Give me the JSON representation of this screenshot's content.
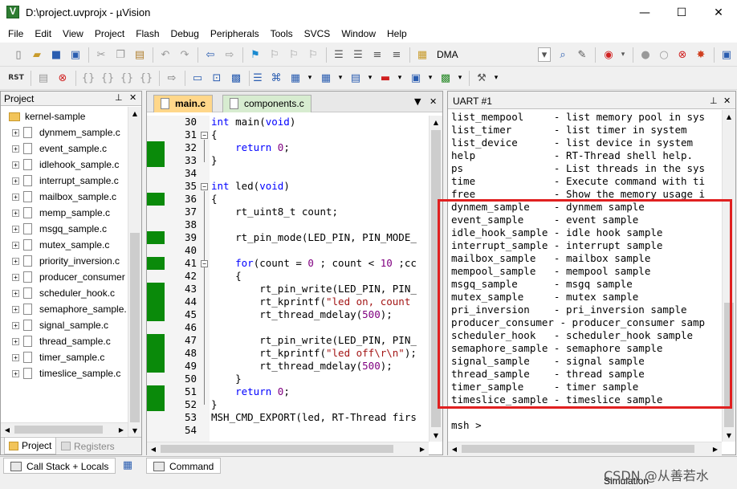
{
  "window": {
    "title": "D:\\project.uvprojx - µVision",
    "minimize": "—",
    "maximize": "☐",
    "close": "✕"
  },
  "menu": [
    "File",
    "Edit",
    "View",
    "Project",
    "Flash",
    "Debug",
    "Peripherals",
    "Tools",
    "SVCS",
    "Window",
    "Help"
  ],
  "toolbar": {
    "target": "DMA"
  },
  "project_panel": {
    "title": "Project",
    "root": "kernel-sample",
    "files": [
      "dynmem_sample.c",
      "event_sample.c",
      "idlehook_sample.c",
      "interrupt_sample.c",
      "mailbox_sample.c",
      "memp_sample.c",
      "msgq_sample.c",
      "mutex_sample.c",
      "priority_inversion.c",
      "producer_consumer",
      "scheduler_hook.c",
      "semaphore_sample.",
      "signal_sample.c",
      "thread_sample.c",
      "timer_sample.c",
      "timeslice_sample.c"
    ],
    "tabs": [
      "Project",
      "Registers"
    ]
  },
  "editor": {
    "tabs": [
      "main.c",
      "components.c"
    ],
    "line_numbers": [
      "30",
      "31",
      "32",
      "33",
      "34",
      "35",
      "36",
      "37",
      "38",
      "39",
      "40",
      "41",
      "42",
      "43",
      "44",
      "45",
      "46",
      "47",
      "48",
      "49",
      "50",
      "51",
      "52",
      "53",
      "54"
    ]
  },
  "uart": {
    "title": "UART #1",
    "lines": [
      "list_mempool     - list memory pool in sys",
      "list_timer       - list timer in system",
      "list_device      - list device in system",
      "help             - RT-Thread shell help.",
      "ps               - List threads in the sys",
      "time             - Execute command with ti",
      "free             - Show the memory usage i",
      "dynmem_sample    - dynmem sample",
      "event_sample     - event sample",
      "idle_hook_sample - idle hook sample",
      "interrupt_sample - interrupt sample",
      "mailbox_sample   - mailbox sample",
      "mempool_sample   - mempool sample",
      "msgq_sample      - msgq sample",
      "mutex_sample     - mutex sample",
      "pri_inversion    - pri_inversion sample",
      "producer_consumer - producer_consumer samp",
      "scheduler_hook   - scheduler_hook sample",
      "semaphore_sample - semaphore sample",
      "signal_sample    - signal sample",
      "thread_sample    - thread sample",
      "timer_sample     - timer sample",
      "timeslice_sample - timeslice sample",
      "",
      "msh >"
    ]
  },
  "bottom": {
    "tabs": [
      "Call Stack + Locals",
      "Command"
    ],
    "status": "Simulation",
    "watermark": "CSDN @从善若水"
  }
}
